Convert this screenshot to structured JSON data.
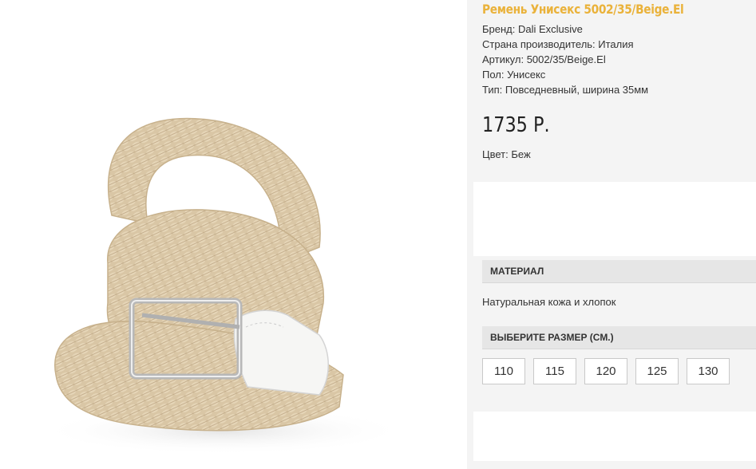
{
  "product": {
    "title": "Ремень Унисекс 5002/35/Beige.El",
    "brand": "Бренд: Dali Exclusive",
    "country": "Страна производитель: Италия",
    "article": "Артикул: 5002/35/Beige.El",
    "gender": "Пол: Унисекс",
    "type": "Тип: Повседневный, ширина 35мм",
    "price": "1735 Р.",
    "color": "Цвет: Беж"
  },
  "material": {
    "header": "МАТЕРИАЛ",
    "value": "Натуральная кожа и хлопок"
  },
  "sizes": {
    "header": "ВЫБЕРИТЕ РАЗМЕР (СМ.)",
    "options": [
      "110",
      "115",
      "120",
      "125",
      "130"
    ]
  },
  "colors": {
    "title": "#eab23a",
    "belt": "#d8c4a4",
    "panel": "#f4f4f4",
    "header_bg": "#e6e6e6"
  }
}
